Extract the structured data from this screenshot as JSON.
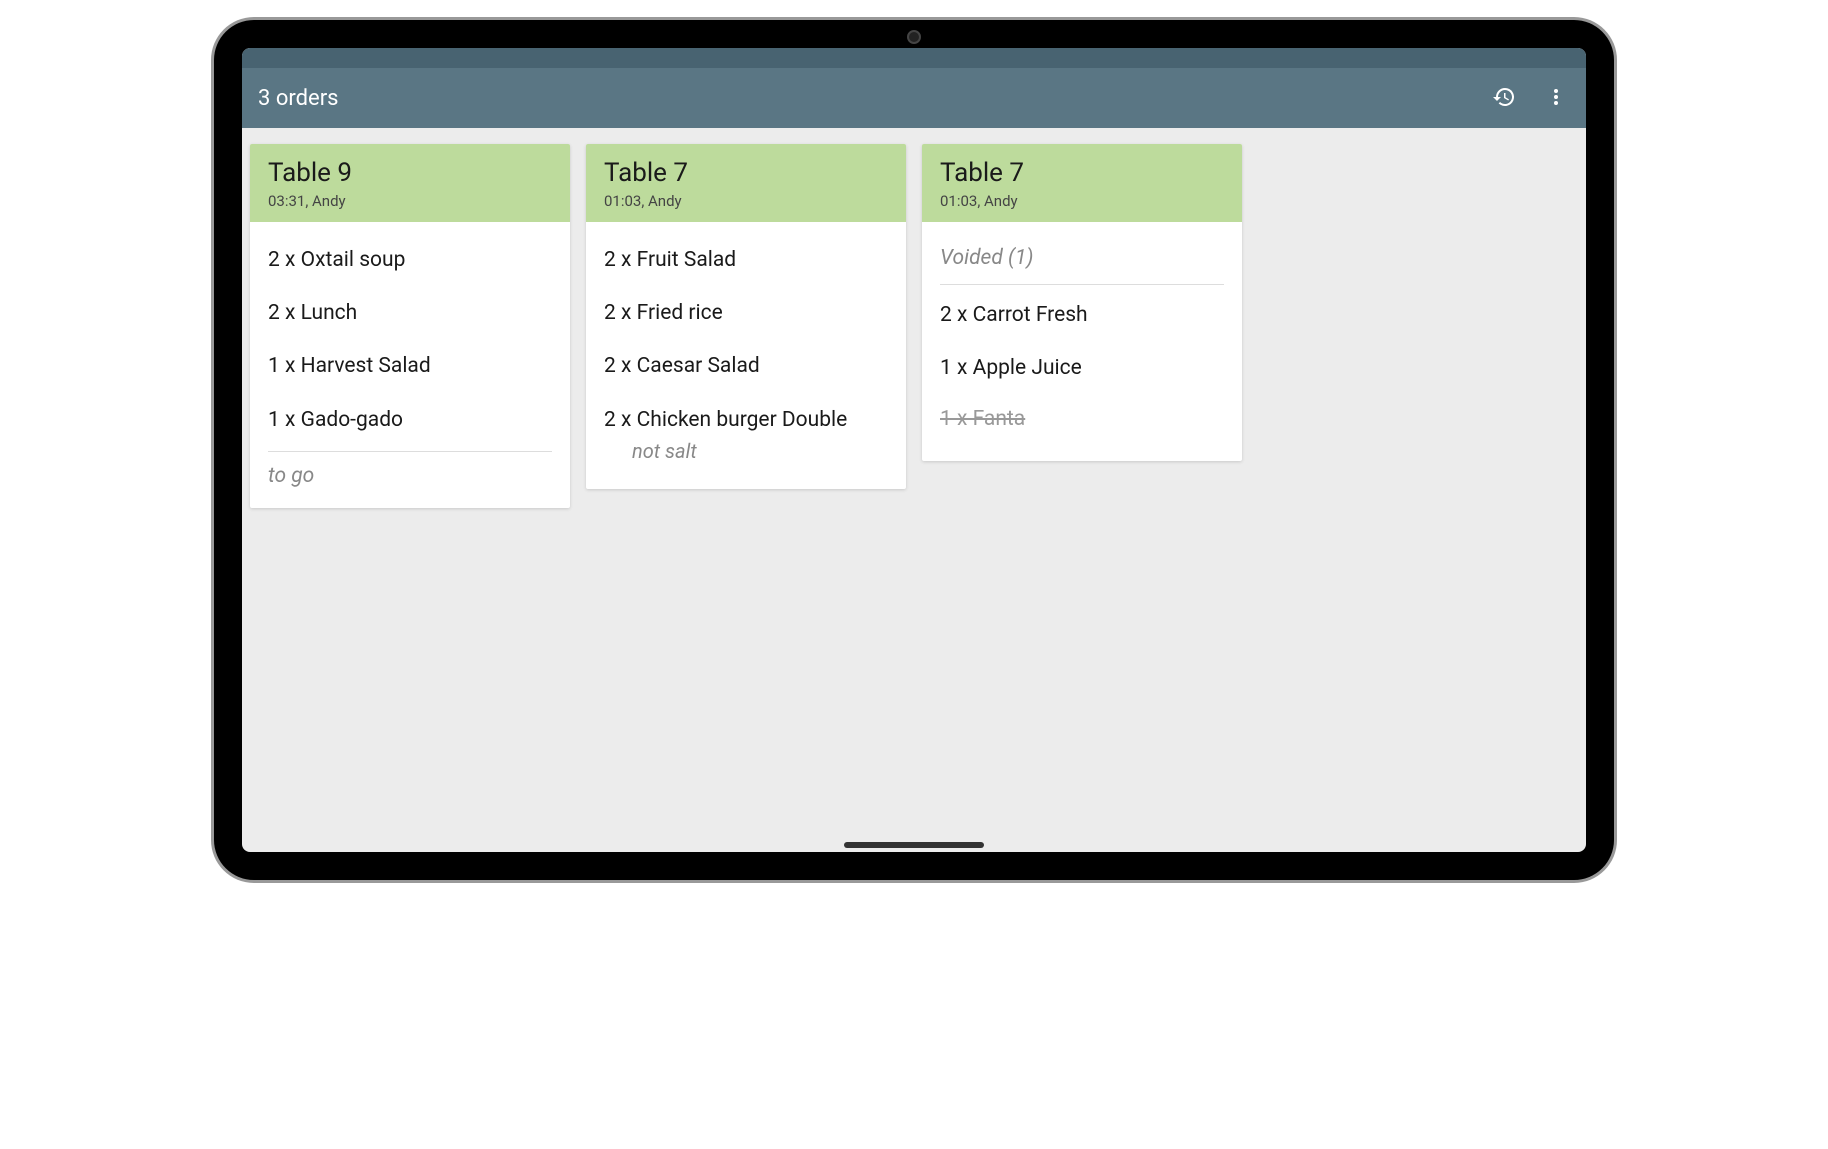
{
  "header": {
    "title": "3 orders"
  },
  "orders": [
    {
      "title": "Table 9",
      "meta": "03:31, Andy",
      "items": [
        {
          "text": "2 x Oxtail soup"
        },
        {
          "text": "2 x Lunch"
        },
        {
          "text": "1 x Harvest Salad"
        },
        {
          "text": "1 x Gado-gado"
        }
      ],
      "footer_note": "to go"
    },
    {
      "title": "Table 7",
      "meta": "01:03, Andy",
      "items": [
        {
          "text": "2 x Fruit Salad"
        },
        {
          "text": "2 x Fried rice"
        },
        {
          "text": "2 x Caesar Salad"
        },
        {
          "text": "2 x Chicken burger Double",
          "note": "not salt"
        }
      ]
    },
    {
      "title": "Table 7",
      "meta": "01:03, Andy",
      "voided_label": "Voided (1)",
      "items": [
        {
          "text": "2 x Carrot Fresh"
        },
        {
          "text": "1 x Apple Juice"
        }
      ],
      "voided_items": [
        {
          "text": "1 x Fanta"
        }
      ]
    }
  ]
}
